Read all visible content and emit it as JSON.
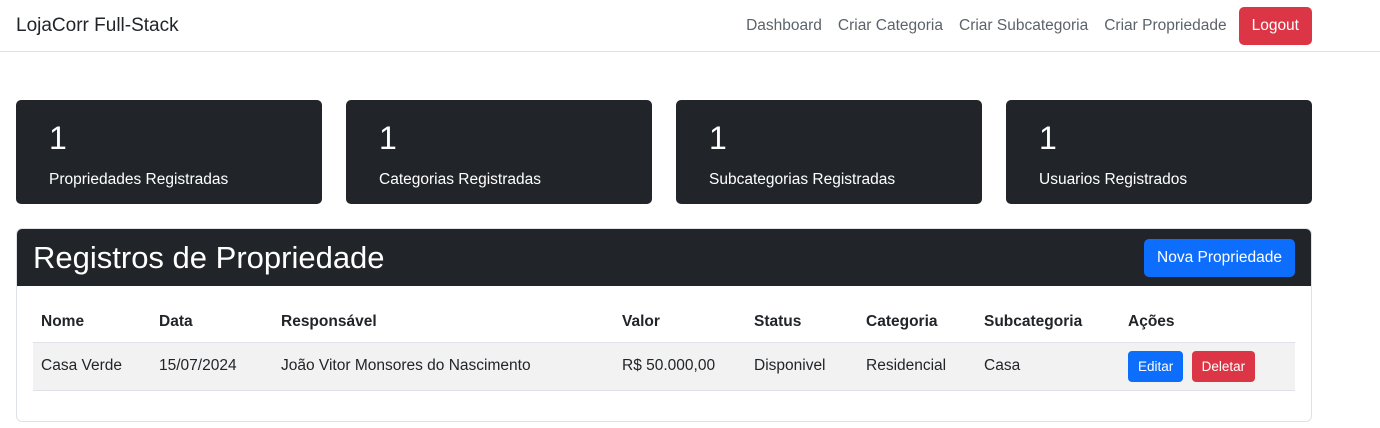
{
  "navbar": {
    "brand": "LojaCorr Full-Stack",
    "links": [
      "Dashboard",
      "Criar Categoria",
      "Criar Subcategoria",
      "Criar Propriedade"
    ],
    "logout_label": "Logout"
  },
  "cards": [
    {
      "count": "1",
      "label": "Propriedades Registradas"
    },
    {
      "count": "1",
      "label": "Categorias Registradas"
    },
    {
      "count": "1",
      "label": "Subcategorias Registradas"
    },
    {
      "count": "1",
      "label": "Usuarios Registrados"
    }
  ],
  "panel": {
    "title": "Registros de Propriedade",
    "new_button": "Nova Propriedade"
  },
  "table": {
    "headers": [
      "Nome",
      "Data",
      "Responsável",
      "Valor",
      "Status",
      "Categoria",
      "Subcategoria",
      "Ações"
    ],
    "rows": [
      {
        "nome": "Casa Verde",
        "data": "15/07/2024",
        "responsavel": "João Vitor Monsores do Nascimento",
        "valor": "R$ 50.000,00",
        "status": "Disponivel",
        "categoria": "Residencial",
        "subcategoria": "Casa",
        "edit_label": "Editar",
        "delete_label": "Deletar"
      }
    ]
  },
  "colors": {
    "dark": "#212529",
    "primary": "#0d6efd",
    "danger": "#dc3545"
  }
}
